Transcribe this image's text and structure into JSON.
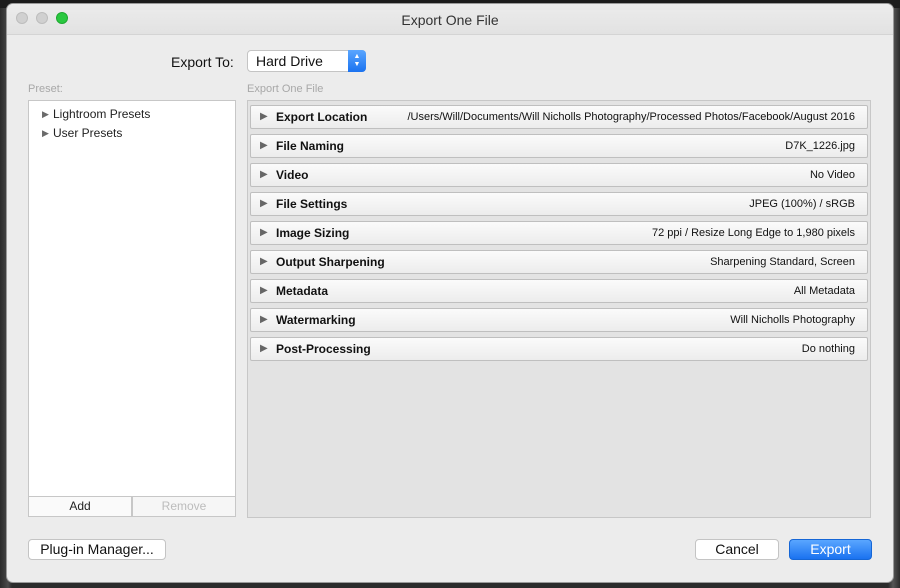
{
  "window": {
    "title": "Export One File"
  },
  "export_to": {
    "label": "Export To:",
    "value": "Hard Drive"
  },
  "preset": {
    "label": "Preset:",
    "items": [
      {
        "label": "Lightroom Presets"
      },
      {
        "label": "User Presets"
      }
    ],
    "add_label": "Add",
    "remove_label": "Remove"
  },
  "main": {
    "label": "Export One File",
    "sections": [
      {
        "name": "Export Location",
        "summary": "/Users/Will/Documents/Will Nicholls Photography/Processed Photos/Facebook/August 2016"
      },
      {
        "name": "File Naming",
        "summary": "D7K_1226.jpg"
      },
      {
        "name": "Video",
        "summary": "No Video"
      },
      {
        "name": "File Settings",
        "summary": "JPEG (100%) / sRGB"
      },
      {
        "name": "Image Sizing",
        "summary": "72 ppi / Resize Long Edge to 1,980 pixels"
      },
      {
        "name": "Output Sharpening",
        "summary": "Sharpening Standard, Screen"
      },
      {
        "name": "Metadata",
        "summary": "All Metadata"
      },
      {
        "name": "Watermarking",
        "summary": "Will Nicholls Photography"
      },
      {
        "name": "Post-Processing",
        "summary": "Do nothing"
      }
    ]
  },
  "footer": {
    "plugin_manager_label": "Plug-in Manager...",
    "cancel_label": "Cancel",
    "export_label": "Export"
  },
  "colors": {
    "accent": "#1a72f0",
    "zoom_button": "#2ac840"
  }
}
